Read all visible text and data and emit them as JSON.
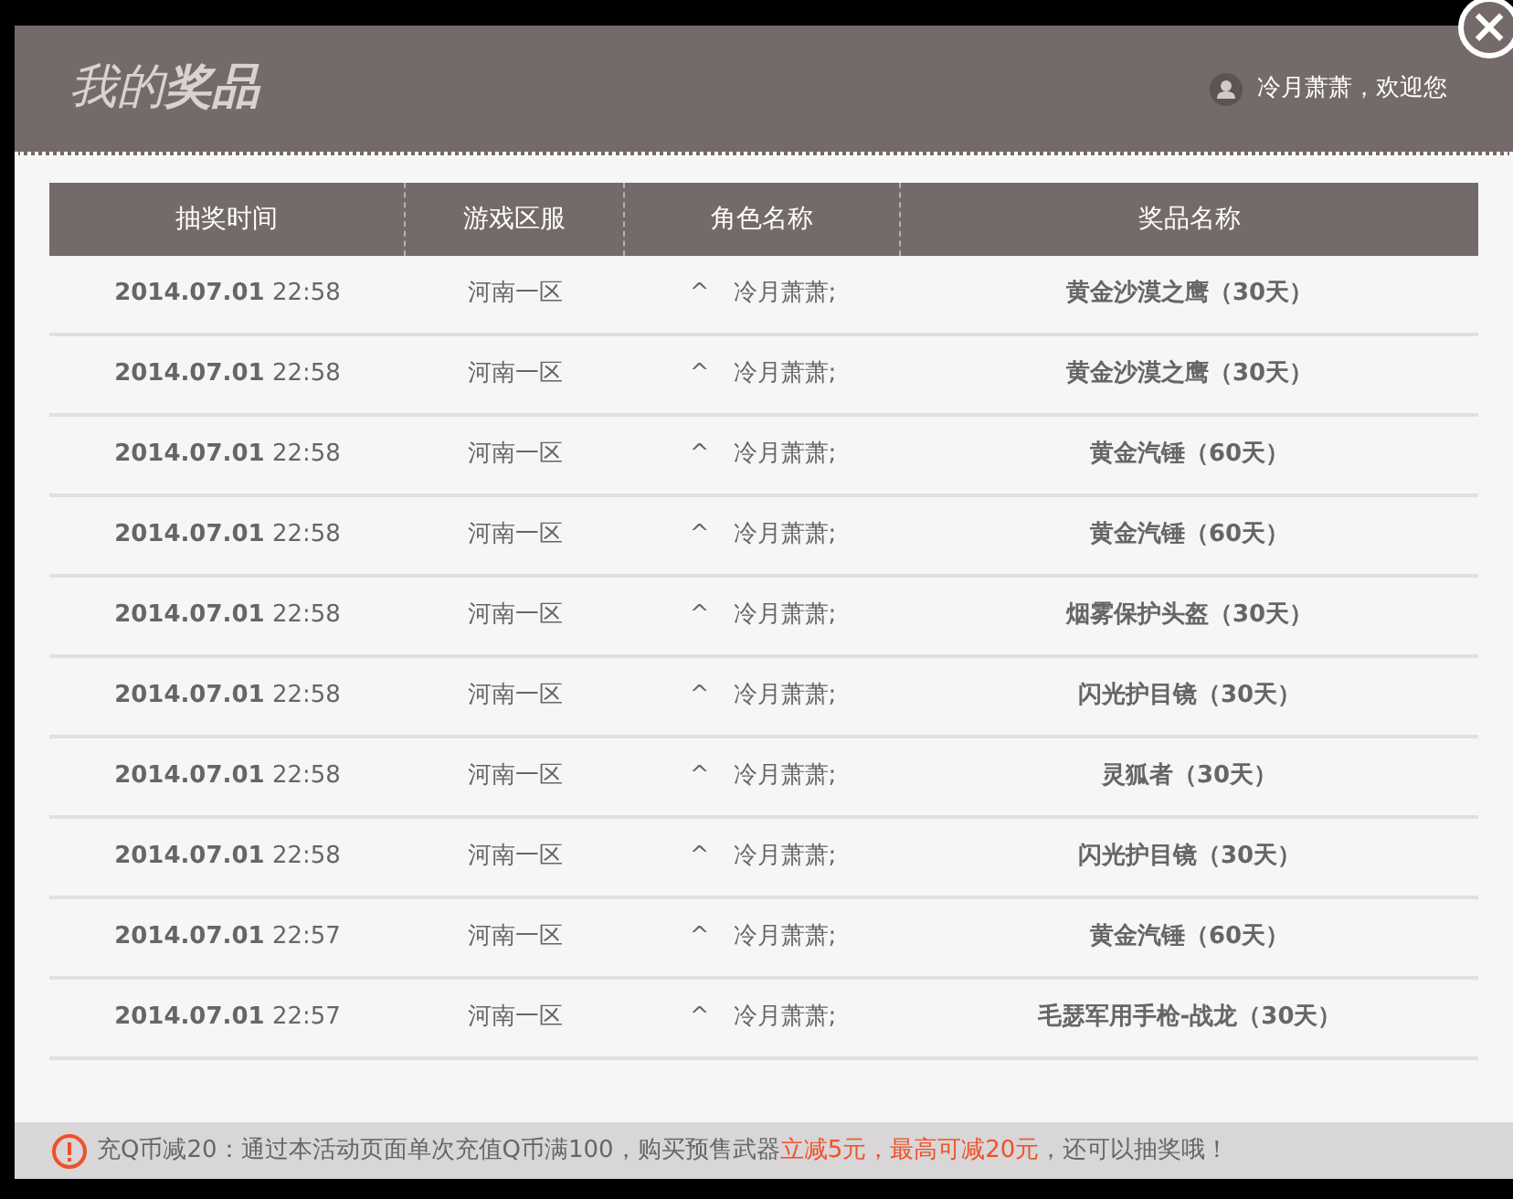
{
  "dialog": {
    "title": "我的**奖品**",
    "user": "冷月萧萧，欢迎您",
    "close": "×"
  },
  "table": {
    "columns": [
      "抽奖时间",
      "游戏区服",
      "角色名称",
      "奖品名称"
    ],
    "rows": [
      {
        "time": "**2014.07.01** 22:58",
        "server": "河南一区",
        "role": "^　冷月萧萧;",
        "prize": "黄金沙漠之鹰（30天）"
      },
      {
        "time": "**2014.07.01** 22:58",
        "server": "河南一区",
        "role": "^　冷月萧萧;",
        "prize": "黄金沙漠之鹰（30天）"
      },
      {
        "time": "**2014.07.01** 22:58",
        "server": "河南一区",
        "role": "^　冷月萧萧;",
        "prize": "黄金汽锤（60天）"
      },
      {
        "time": "**2014.07.01** 22:58",
        "server": "河南一区",
        "role": "^　冷月萧萧;",
        "prize": "黄金汽锤（60天）"
      },
      {
        "time": "**2014.07.01** 22:58",
        "server": "河南一区",
        "role": "^　冷月萧萧;",
        "prize": "烟雾保护头盔（30天）"
      },
      {
        "time": "**2014.07.01** 22:58",
        "server": "河南一区",
        "role": "^　冷月萧萧;",
        "prize": "闪光护目镜（30天）"
      },
      {
        "time": "**2014.07.01** 22:58",
        "server": "河南一区",
        "role": "^　冷月萧萧;",
        "prize": "灵狐者（30天）"
      },
      {
        "time": "**2014.07.01** 22:58",
        "server": "河南一区",
        "role": "^　冷月萧萧;",
        "prize": "闪光护目镜（30天）"
      },
      {
        "time": "**2014.07.01** 22:57",
        "server": "河南一区",
        "role": "^　冷月萧萧;",
        "prize": "黄金汽锤（60天）"
      },
      {
        "time": "**2014.07.01** 22:57",
        "server": "河南一区",
        "role": "^　冷月萧萧;",
        "prize": "毛瑟军用手枪-战龙（30天）"
      }
    ]
  },
  "notice": {
    "segments": [
      {
        "kind": "normal",
        "text": "充Q币减20：通过本活动页面单次充值Q币满100，购买预售武器"
      },
      {
        "kind": "highlight",
        "text": "立减5元，最高可减20元"
      },
      {
        "kind": "normal",
        "text": "，还可以抽奖哦！"
      }
    ]
  }
}
